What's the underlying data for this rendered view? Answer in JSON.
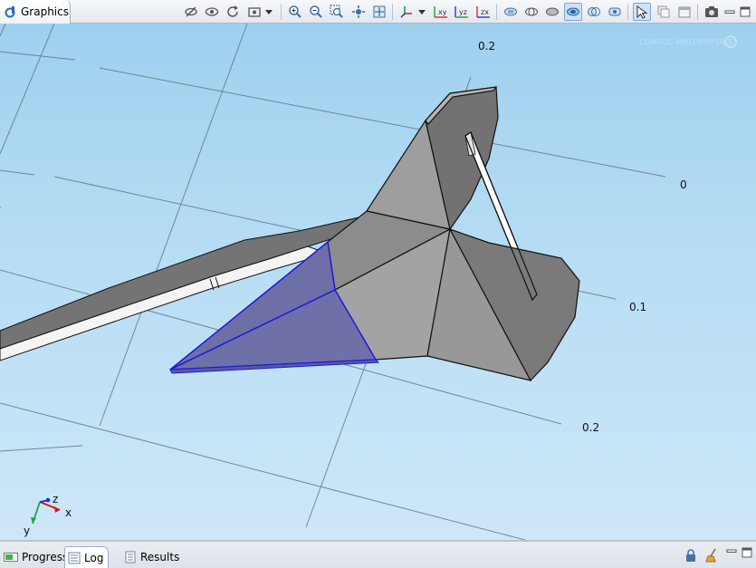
{
  "graphics_tab": {
    "title": "Graphics",
    "icon": "comsol-graphics-icon"
  },
  "toolbar": {
    "items": [
      {
        "name": "hide-icon"
      },
      {
        "name": "show-icon"
      },
      {
        "name": "reset-icon"
      },
      {
        "name": "view-dropdown-icon"
      },
      {
        "name": "zoom-in-icon"
      },
      {
        "name": "zoom-out-icon"
      },
      {
        "name": "zoom-box-icon"
      },
      {
        "name": "zoom-selected-icon"
      },
      {
        "name": "zoom-extents-icon"
      },
      {
        "name": "axes-orientation-icon"
      },
      {
        "name": "view-xy-icon",
        "label": "xy"
      },
      {
        "name": "view-yz-icon",
        "label": "yz"
      },
      {
        "name": "view-zx-icon",
        "label": "zx"
      },
      {
        "name": "transparency-icon"
      },
      {
        "name": "wireframe-icon"
      },
      {
        "name": "render-icon"
      },
      {
        "name": "select-objects-icon"
      },
      {
        "name": "select-domains-icon"
      },
      {
        "name": "select-boundaries-icon"
      },
      {
        "name": "select-mode-icon"
      },
      {
        "name": "copy-icon"
      },
      {
        "name": "paste-icon"
      },
      {
        "name": "screenshot-icon"
      }
    ],
    "window_controls": [
      "minimize-icon",
      "maximize-icon"
    ]
  },
  "viewport": {
    "axis_labels": [
      "0.2",
      "0",
      "0.1",
      "0.2"
    ],
    "watermark": "COMSOL MULTIPHYSICS",
    "triad": {
      "x": "x",
      "y": "y",
      "z": "z"
    },
    "colors": {
      "background_top": "#9fd0ef",
      "background_bottom": "#cde7f8",
      "part_face": "#9a9a9a",
      "part_dark": "#737373",
      "selection": "#6e6fa6",
      "selection_edge": "#1a1ae0"
    }
  },
  "bottom_tabs": [
    {
      "label": "Progress",
      "icon": "progress-icon",
      "active": false
    },
    {
      "label": "Log",
      "icon": "log-icon",
      "active": true
    },
    {
      "label": "Results",
      "icon": "results-icon",
      "active": false
    }
  ]
}
